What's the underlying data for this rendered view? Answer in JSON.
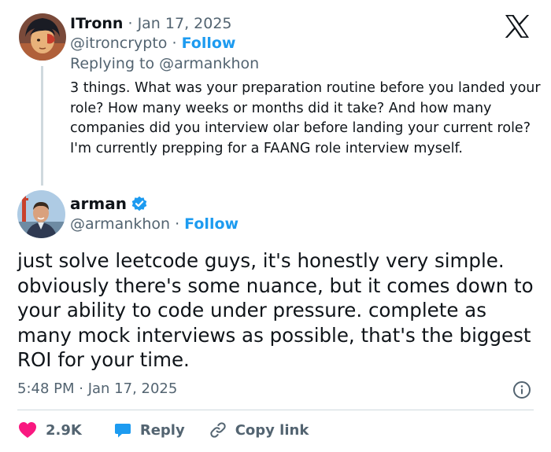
{
  "parent_tweet": {
    "display_name": "ITronn",
    "separator": "·",
    "date": "Jan 17, 2025",
    "handle": "@itroncrypto",
    "follow_label": "Follow",
    "replying_prefix": "Replying to ",
    "replying_to": "@armankhon",
    "text": "3 things. What was your preparation routine before you landed your role? How many weeks or months did it take? And how many companies did you interview olar before landing your current role? I'm currently prepping for a FAANG role interview myself."
  },
  "main_tweet": {
    "display_name": "arman",
    "verified": true,
    "handle": "@armankhon",
    "separator": "·",
    "follow_label": "Follow",
    "text": "just solve leetcode guys, it's honestly very simple. obviously there's some nuance, but it comes down to your ability to code under pressure. complete as many mock interviews as possible, that's the biggest ROI for your time.",
    "timestamp": "5:48 PM · Jan 17, 2025"
  },
  "actions": {
    "likes": "2.9K",
    "reply_label": "Reply",
    "copy_link_label": "Copy link"
  },
  "icons": {
    "platform": "x-logo-icon",
    "verified": "verified-badge-icon",
    "info": "info-icon",
    "like": "heart-icon",
    "reply": "reply-bubble-icon",
    "copy": "link-icon"
  },
  "colors": {
    "text": "#0f1419",
    "muted": "#536471",
    "accent": "#1d9bf0",
    "like": "#f91880",
    "divider": "#cfd9de"
  }
}
